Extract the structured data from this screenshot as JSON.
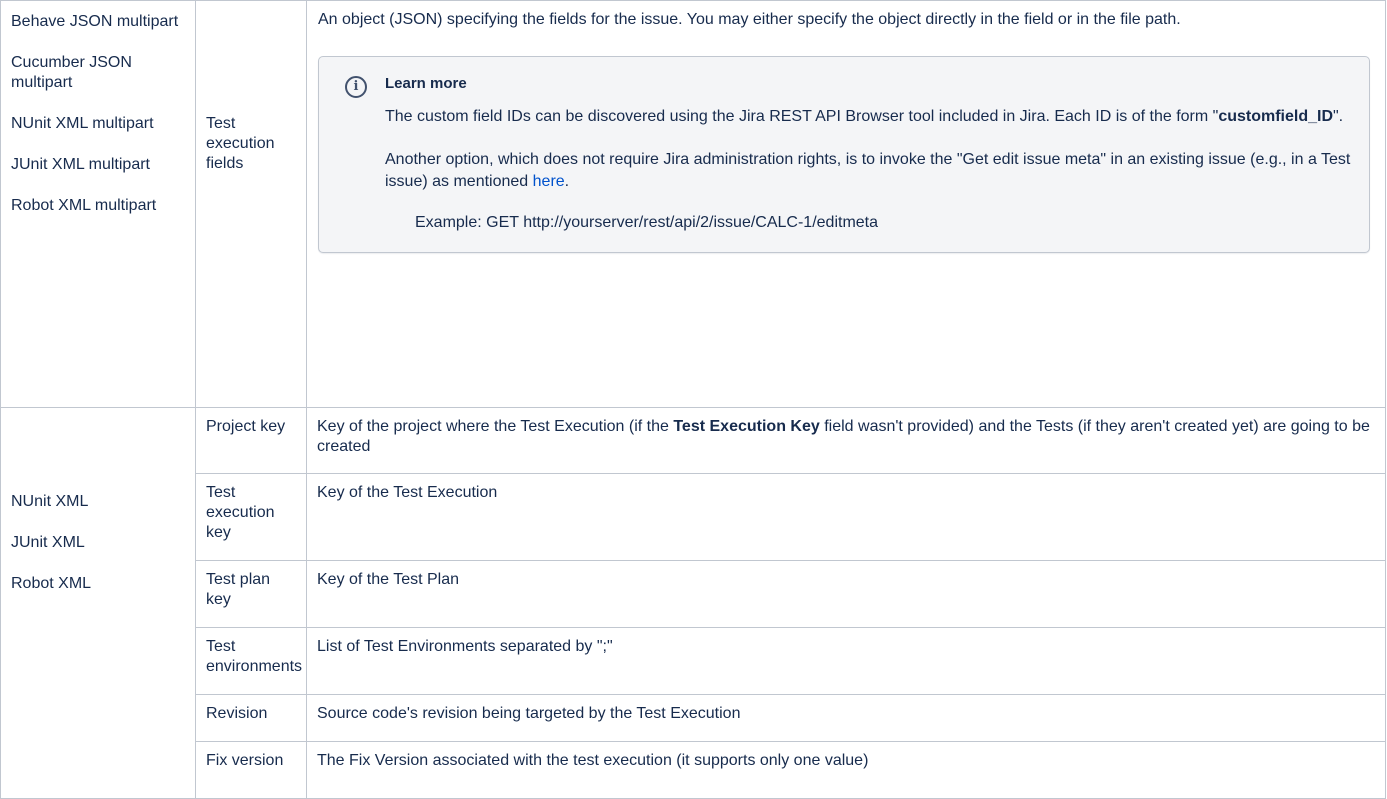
{
  "row1": {
    "formats": [
      "Behave JSON multipart",
      "Cucumber JSON multipart",
      "NUnit XML multipart",
      "JUnit XML multipart",
      "Robot XML multipart"
    ],
    "field": "Test execution fields",
    "description": "An object (JSON) specifying the fields for the issue. You may either specify the object directly in the field or in the file path.",
    "info_panel": {
      "icon": "info-icon",
      "title": "Learn more",
      "p1_before": "The custom field IDs can be discovered using the Jira REST API Browser tool included in Jira. Each ID is of the form \"",
      "p1_bold": "customfield_ID",
      "p1_after": "\".",
      "p2_before": "Another option, which does not require Jira administration rights, is to invoke the \"Get edit issue meta\" in an existing issue (e.g., in a Test issue) as mentioned ",
      "p2_link": "here",
      "p2_after": ".",
      "example": "Example: GET http://yourserver/rest/api/2/issue/CALC-1/editmeta"
    }
  },
  "row2": {
    "formats": [
      "NUnit XML",
      "JUnit XML",
      "Robot XML"
    ],
    "fields": [
      {
        "name": "Project key",
        "desc_before": "Key of the project where the Test Execution (if the ",
        "desc_bold": "Test Execution Key",
        "desc_after": " field wasn't provided) and the Tests (if they aren't created yet) are going to be created"
      },
      {
        "name": "Test execution key",
        "desc": "Key of the Test Execution"
      },
      {
        "name": "Test plan key",
        "desc": "Key of the Test Plan"
      },
      {
        "name": "Test environments",
        "desc": "List of Test Environments separated by \";\""
      },
      {
        "name": "Revision",
        "desc": "Source code's revision being targeted by the Test Execution"
      },
      {
        "name": "Fix version",
        "desc": "The Fix Version associated with the test execution (it supports only one value)"
      }
    ]
  }
}
